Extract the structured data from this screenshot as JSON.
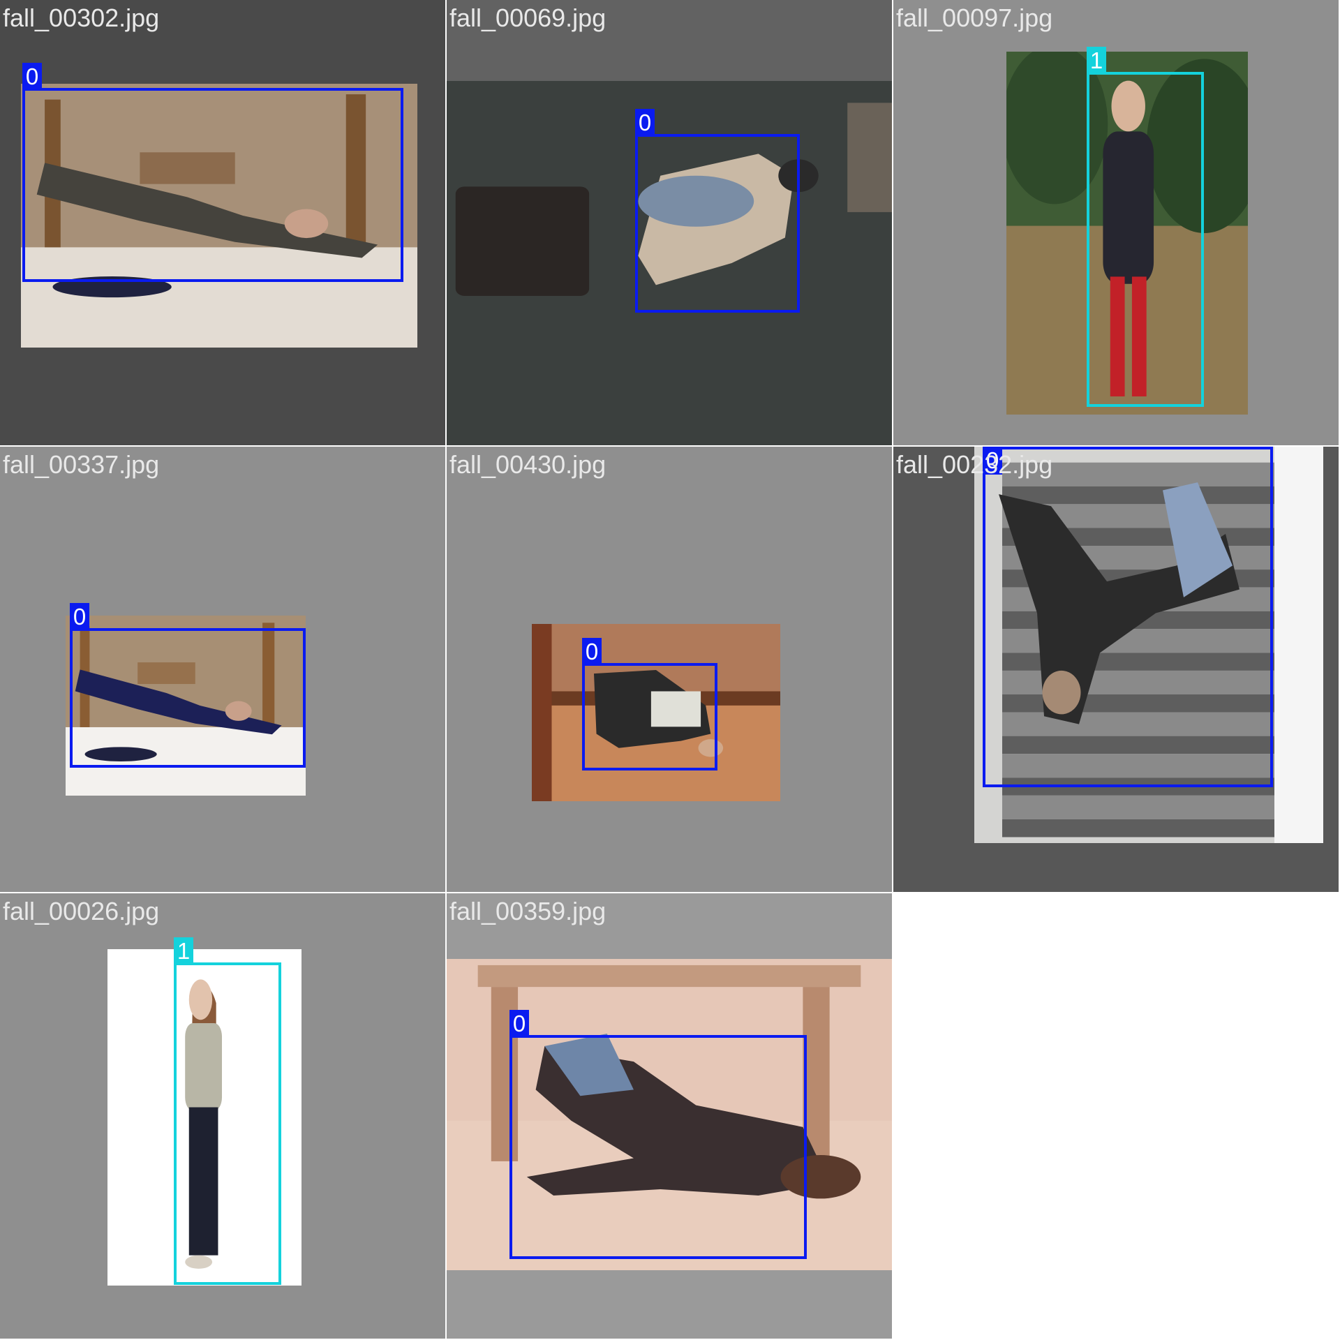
{
  "class_colors": {
    "0": "#0a1bf0",
    "1": "#14d2dc"
  },
  "tiles": [
    {
      "filename": "fall_00302.jpg",
      "background": "#4a4a4a",
      "scene": {
        "kind": "indoor-fall",
        "bg": "#a79078",
        "floor": "#e3dcd3",
        "accent": "#7a5430",
        "figure": "#45433d"
      },
      "detections": [
        {
          "label": "0"
        }
      ]
    },
    {
      "filename": "fall_00069.jpg",
      "background": "#626262",
      "scene": {
        "kind": "overhead-fall",
        "bg": "#3b403e",
        "floor": "#3b403e",
        "accent": "#2b2624",
        "figure": "#c9b9a5"
      },
      "detections": [
        {
          "label": "0"
        }
      ]
    },
    {
      "filename": "fall_00097.jpg",
      "background": "#8f8f8f",
      "scene": {
        "kind": "outdoor-standing",
        "bg": "#3f5c35",
        "floor": "#8f7a52",
        "accent": "#c22128",
        "figure": "#262630"
      },
      "detections": [
        {
          "label": "1"
        }
      ]
    },
    {
      "filename": "fall_00337.jpg",
      "background": "#8f8f8f",
      "scene": {
        "kind": "indoor-fall",
        "bg": "#a78f74",
        "floor": "#f3f1ee",
        "accent": "#8a5d33",
        "figure": "#1c2057"
      },
      "detections": [
        {
          "label": "0"
        }
      ]
    },
    {
      "filename": "fall_00430.jpg",
      "background": "#8f8f8f",
      "scene": {
        "kind": "wood-floor-fall",
        "bg": "#b07a5a",
        "floor": "#c8875a",
        "accent": "#6b3b22",
        "figure": "#2a2a2a"
      },
      "detections": [
        {
          "label": "0"
        }
      ]
    },
    {
      "filename": "fall_00232.jpg",
      "background": "#575757",
      "scene": {
        "kind": "stairs-fall",
        "bg": "#d4d4d2",
        "floor": "#7c7c7c",
        "accent": "#f5f5f5",
        "figure": "#2b2b2b"
      },
      "detections": [
        {
          "label": "0"
        }
      ]
    },
    {
      "filename": "fall_00026.jpg",
      "background": "#8f8f8f",
      "scene": {
        "kind": "studio-standing",
        "bg": "#ffffff",
        "floor": "#ffffff",
        "accent": "#8a5a3a",
        "figure": "#1e2130"
      },
      "detections": [
        {
          "label": "1"
        }
      ]
    },
    {
      "filename": "fall_00359.jpg",
      "background": "#9a9a9a",
      "scene": {
        "kind": "table-fall",
        "bg": "#e6c7b7",
        "floor": "#e9cdbd",
        "accent": "#c39a7f",
        "figure": "#3a2f30"
      },
      "detections": [
        {
          "label": "0"
        }
      ]
    }
  ]
}
